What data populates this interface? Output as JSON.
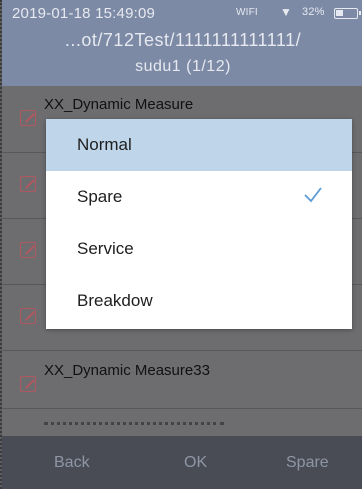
{
  "status_bar": {
    "time": "2019-01-18 15:49:09",
    "wifi": "WIFI",
    "battery": "32%",
    "wifi_icon": "wifi-signal-icon",
    "battery_icon": "battery-icon"
  },
  "header": {
    "path": "...ot/712Test/1111111111111/",
    "subtitle": "sudu1 (1/12)"
  },
  "list": {
    "items": [
      {
        "label": "XX_Dynamic Measure",
        "icon": "edit-icon"
      },
      {
        "label": "",
        "icon": "edit-icon"
      },
      {
        "label": "",
        "icon": "edit-icon"
      },
      {
        "label": "",
        "icon": "edit-icon"
      },
      {
        "label": "XX_Dynamic Measure33",
        "icon": "edit-icon"
      }
    ]
  },
  "dropdown": {
    "options": [
      {
        "label": "Normal",
        "highlighted": true,
        "checked": false
      },
      {
        "label": "Spare",
        "highlighted": false,
        "checked": true
      },
      {
        "label": "Service",
        "highlighted": false,
        "checked": false
      },
      {
        "label": "Breakdow",
        "highlighted": false,
        "checked": false
      }
    ],
    "highlight_color": "#bfd5ea",
    "check_color": "#5b9bd5"
  },
  "bottom_bar": {
    "back_label": "Back",
    "ok_label": "OK",
    "status_label": "Spare"
  }
}
